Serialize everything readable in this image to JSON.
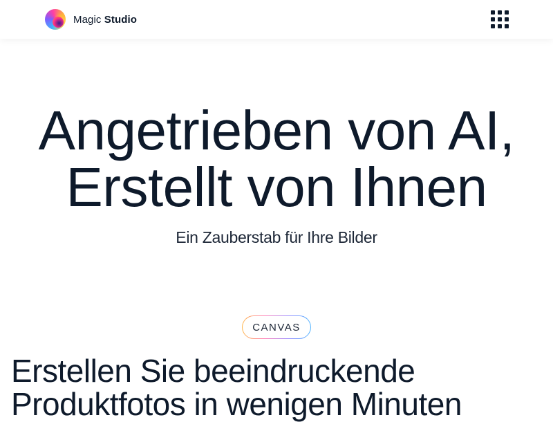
{
  "header": {
    "logo": {
      "icon": "magic-studio-logo-icon",
      "name_light": "Magic",
      "name_bold": "Studio"
    },
    "menu_icon": "grid-menu-icon"
  },
  "hero": {
    "title_line1": "Angetrieben von AI,",
    "title_line2": "Erstellt von Ihnen",
    "subtitle": "Ein Zauberstab für Ihre Bilder"
  },
  "section": {
    "badge": "CANVAS",
    "title_line1": "Erstellen Sie beeindruckende",
    "title_line2": "Produktfotos in wenigen Minuten"
  },
  "colors": {
    "text": "#0e1a2b",
    "background": "#ffffff",
    "badge_gradient": [
      "#ffb74a",
      "#ff7fb8",
      "#9c8cff",
      "#4fb4ff"
    ]
  }
}
